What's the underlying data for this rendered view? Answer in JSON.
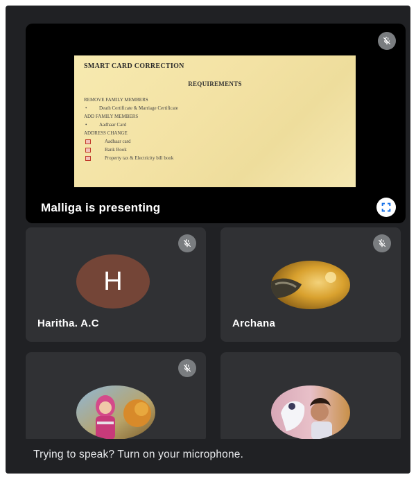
{
  "presentation": {
    "presenting_label": "Malliga is presenting",
    "slide": {
      "title": "SMART CARD CORRECTION",
      "subtitle": "REQUIREMENTS",
      "lines": [
        {
          "style": "head",
          "text": "REMOVE FAMILY MEMBERS"
        },
        {
          "style": "bullet",
          "text": "Death Certificate & Marriage Certificate"
        },
        {
          "style": "head",
          "text": "ADD FAMILY MEMBERS"
        },
        {
          "style": "bullet",
          "text": "Aadhaar Card"
        },
        {
          "style": "head",
          "text": "ADDRESS CHANGE"
        },
        {
          "style": "box",
          "text": "Aadhaar card"
        },
        {
          "style": "box",
          "text": "Bank Book"
        },
        {
          "style": "box",
          "text": "Property tax & Electricity bill book"
        }
      ]
    },
    "mute_icon": "mic-off-icon",
    "fullscreen_icon": "fullscreen-icon"
  },
  "participants": [
    {
      "name": "Haritha. A.C",
      "avatar_letter": "H",
      "avatar_color": "#744537",
      "muted": true
    },
    {
      "name": "Archana",
      "avatar_type": "photo",
      "muted": true
    },
    {
      "name": "",
      "avatar_type": "photo",
      "muted": true
    },
    {
      "name": "",
      "avatar_type": "photo",
      "muted": false
    }
  ],
  "bottom_prompt": "Trying to speak? Turn on your microphone.",
  "colors": {
    "background": "#202124",
    "tile": "#303134",
    "mute_badge": "#7a7d80"
  }
}
